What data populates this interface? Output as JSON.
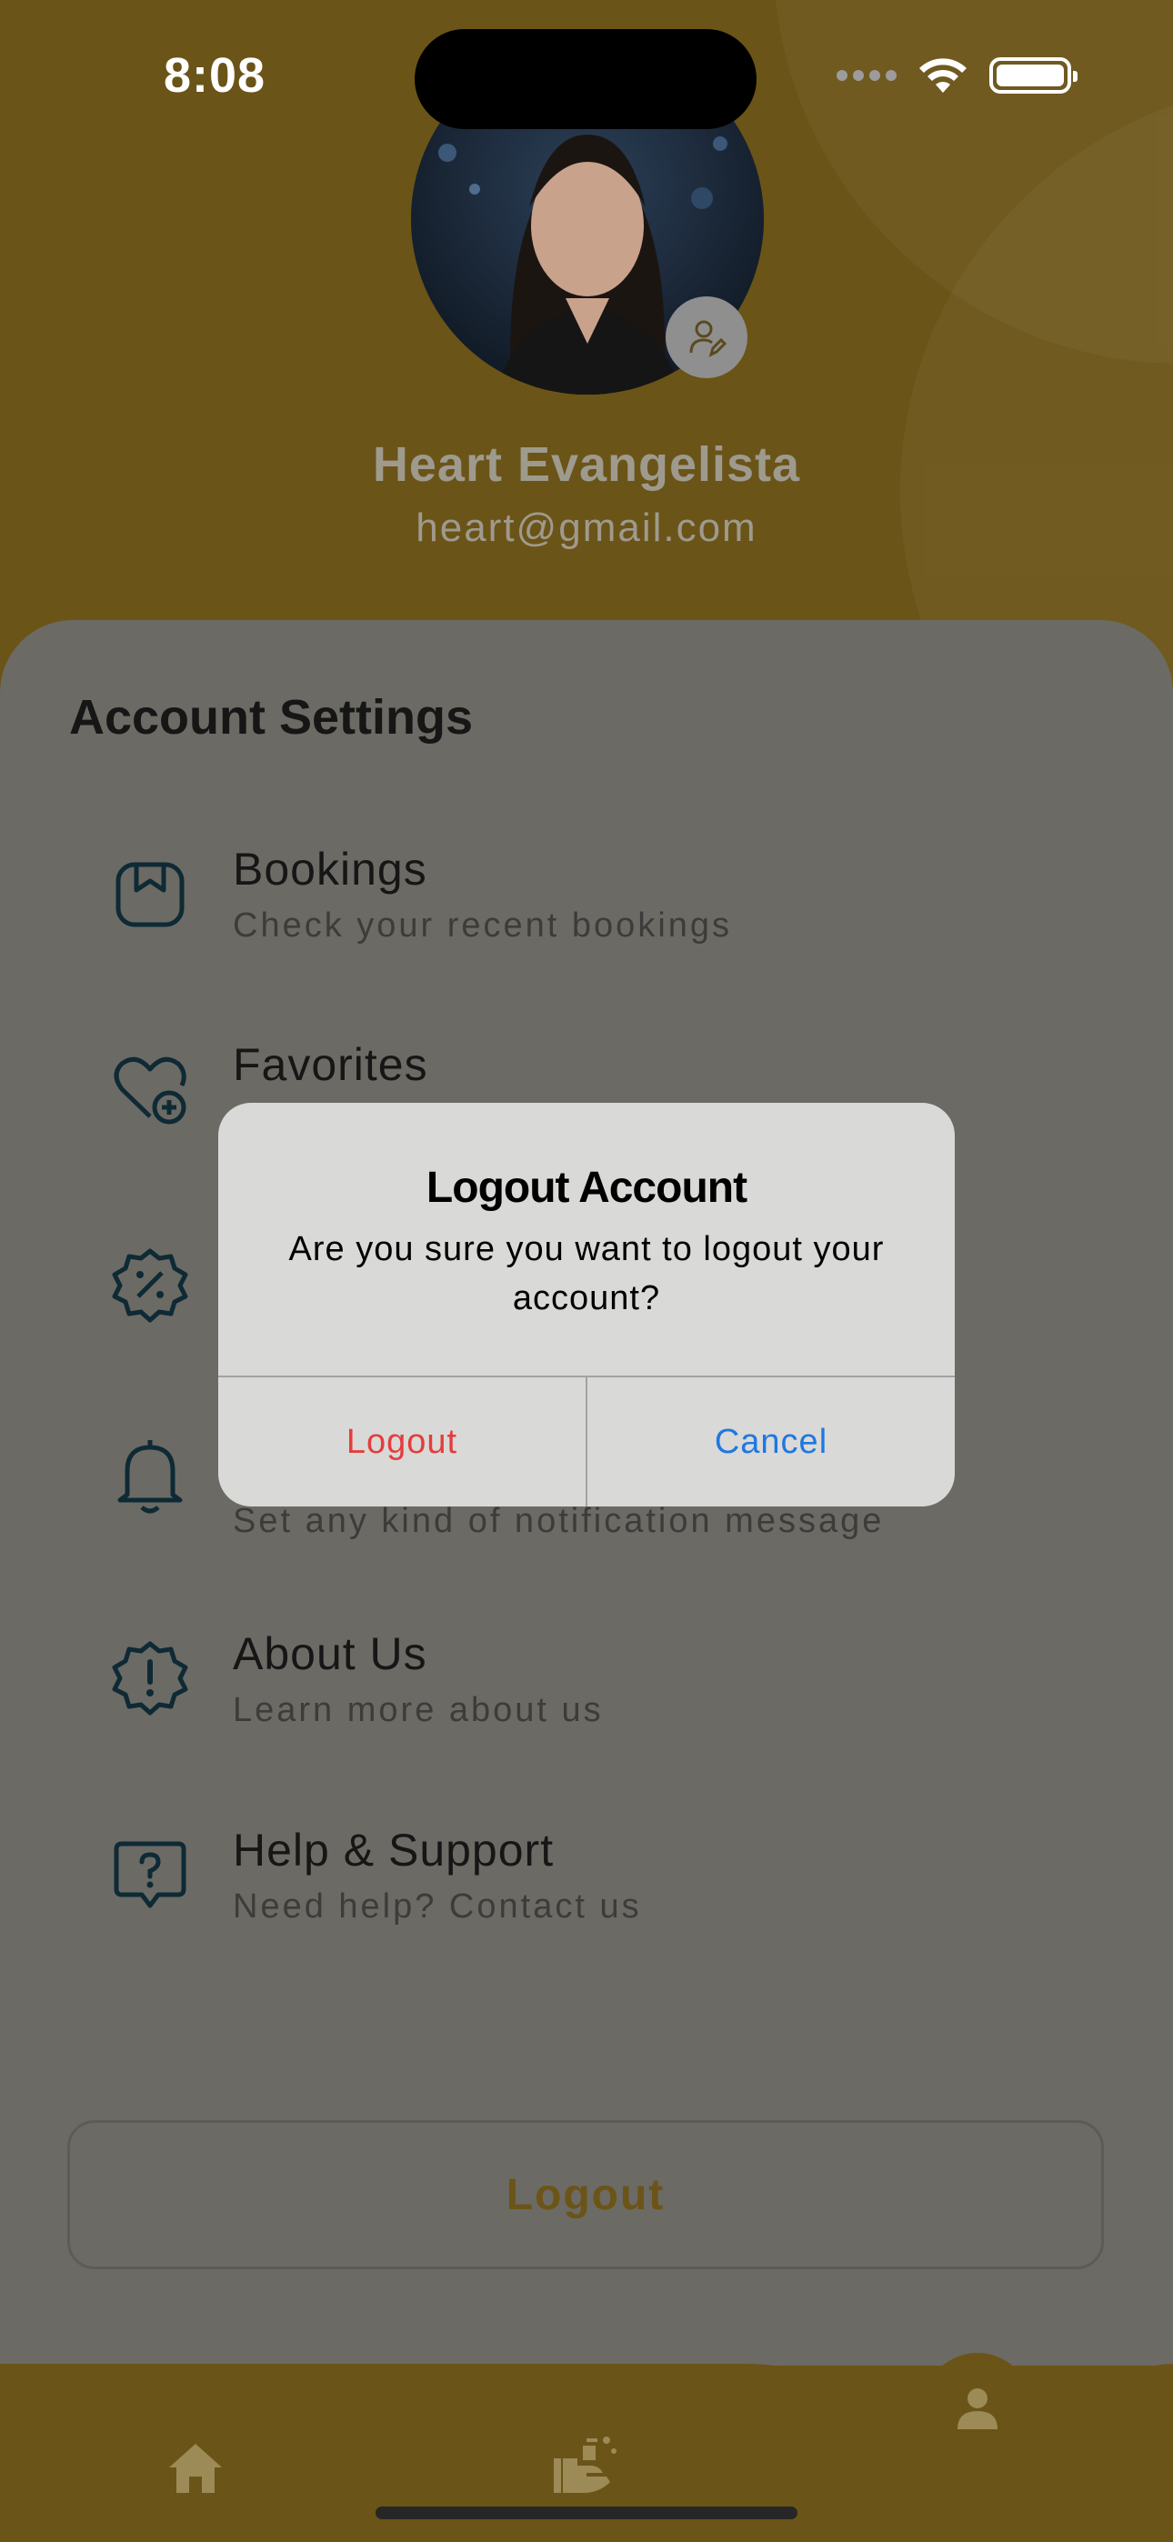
{
  "status_bar": {
    "time": "8:08"
  },
  "profile": {
    "name": "Heart Evangelista",
    "email": "heart@gmail.com"
  },
  "settings": {
    "title": "Account Settings",
    "items": [
      {
        "icon": "bookings-icon",
        "label": "Bookings",
        "sub": "Check your recent bookings"
      },
      {
        "icon": "favorites-icon",
        "label": "Favorites",
        "sub": ""
      },
      {
        "icon": "discount-icon",
        "label": "",
        "sub": ""
      },
      {
        "icon": "bell-icon",
        "label": "",
        "sub": "Set any kind of notification message"
      },
      {
        "icon": "info-icon",
        "label": "About Us",
        "sub": "Learn more about us"
      },
      {
        "icon": "help-icon",
        "label": "Help & Support",
        "sub": "Need help? Contact us"
      }
    ],
    "logout_label": "Logout"
  },
  "dialog": {
    "title": "Logout Account",
    "message": "Are you sure you want to logout your account?",
    "confirm_label": "Logout",
    "cancel_label": "Cancel"
  },
  "colors": {
    "brand": "#6b5417",
    "overlay_sheet": "#6c6a64",
    "destructive": "#e63c3c",
    "link": "#1e78e0"
  }
}
